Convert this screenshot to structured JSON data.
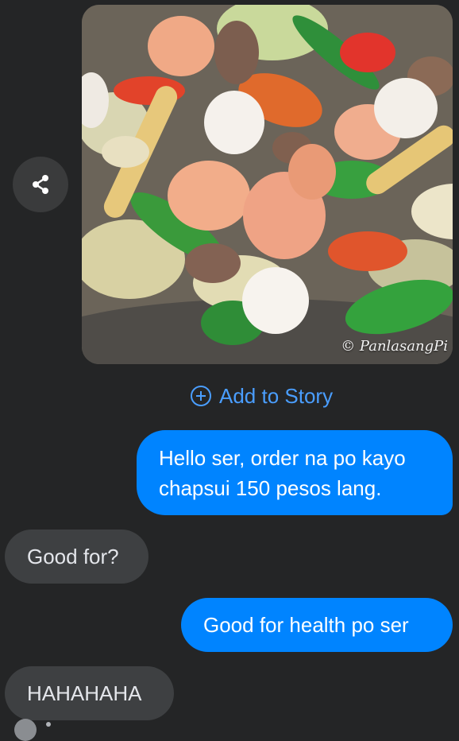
{
  "share": {
    "icon": "share-icon"
  },
  "photo": {
    "watermark": "© PanlasangPi",
    "subject": "chopsuey-dish"
  },
  "add_story": {
    "label": "Add to Story",
    "icon": "add-circle-icon"
  },
  "messages": [
    {
      "direction": "outgoing",
      "text": "Hello ser, order na po kayo chapsui 150 pesos lang."
    },
    {
      "direction": "incoming",
      "text": "Good for?"
    },
    {
      "direction": "outgoing",
      "text": "Good for health po ser"
    },
    {
      "direction": "incoming",
      "text": "HAHAHAHA"
    }
  ],
  "colors": {
    "background": "#242526",
    "outgoing": "#0084ff",
    "incoming": "#3e4042",
    "link": "#4a9eff"
  }
}
